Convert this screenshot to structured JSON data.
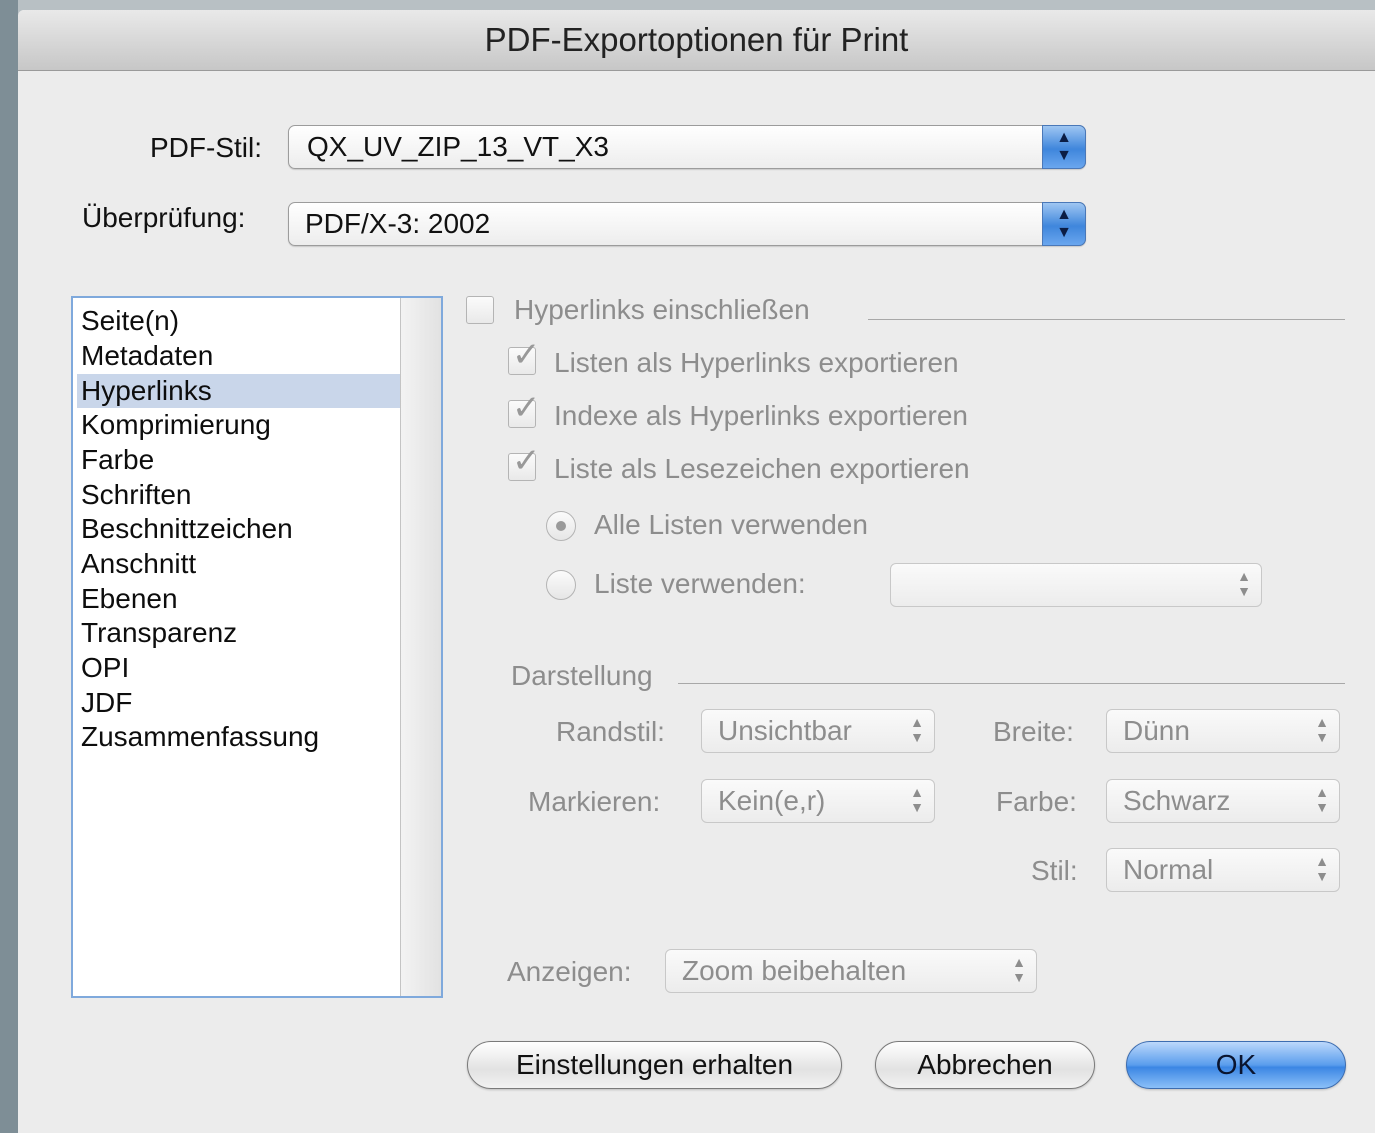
{
  "window": {
    "title": "PDF-Exportoptionen für Print"
  },
  "pdf_style": {
    "label": "PDF-Stil:",
    "value": "QX_UV_ZIP_13_VT_X3"
  },
  "verification": {
    "label": "Überprüfung:",
    "value": "PDF/X-3: 2002"
  },
  "sidebar": {
    "selected": "Hyperlinks",
    "items": [
      {
        "label": "Seite(n)"
      },
      {
        "label": "Metadaten"
      },
      {
        "label": "Hyperlinks"
      },
      {
        "label": "Komprimierung"
      },
      {
        "label": "Farbe"
      },
      {
        "label": "Schriften"
      },
      {
        "label": "Beschnittzeichen"
      },
      {
        "label": "Anschnitt"
      },
      {
        "label": "Ebenen"
      },
      {
        "label": "Transparenz"
      },
      {
        "label": "OPI"
      },
      {
        "label": "JDF"
      },
      {
        "label": "Zusammenfassung"
      }
    ]
  },
  "hyperlinks": {
    "include": {
      "label": "Hyperlinks einschließen",
      "checked": false
    },
    "export_lists": {
      "label": "Listen als Hyperlinks exportieren",
      "checked": true
    },
    "export_indexes": {
      "label": "Indexe als Hyperlinks exportieren",
      "checked": true
    },
    "export_bookmarks": {
      "label": "Liste als Lesezeichen exportieren",
      "checked": true
    },
    "use_all_lists": {
      "label": "Alle Listen verwenden",
      "selected": true
    },
    "use_list": {
      "label": "Liste verwenden:",
      "selected": false,
      "value": ""
    }
  },
  "appearance": {
    "section_title": "Darstellung",
    "border_style": {
      "label": "Randstil:",
      "value": "Unsichtbar"
    },
    "width": {
      "label": "Breite:",
      "value": "Dünn"
    },
    "highlight": {
      "label": "Markieren:",
      "value": "Kein(e,r)"
    },
    "color": {
      "label": "Farbe:",
      "value": "Schwarz"
    },
    "style": {
      "label": "Stil:",
      "value": "Normal"
    }
  },
  "display": {
    "label": "Anzeigen:",
    "value": "Zoom beibehalten"
  },
  "buttons": {
    "keep_settings": "Einstellungen erhalten",
    "cancel": "Abbrechen",
    "ok": "OK"
  },
  "icons": {
    "check": "✓",
    "popup_arrows": "▲▼"
  }
}
